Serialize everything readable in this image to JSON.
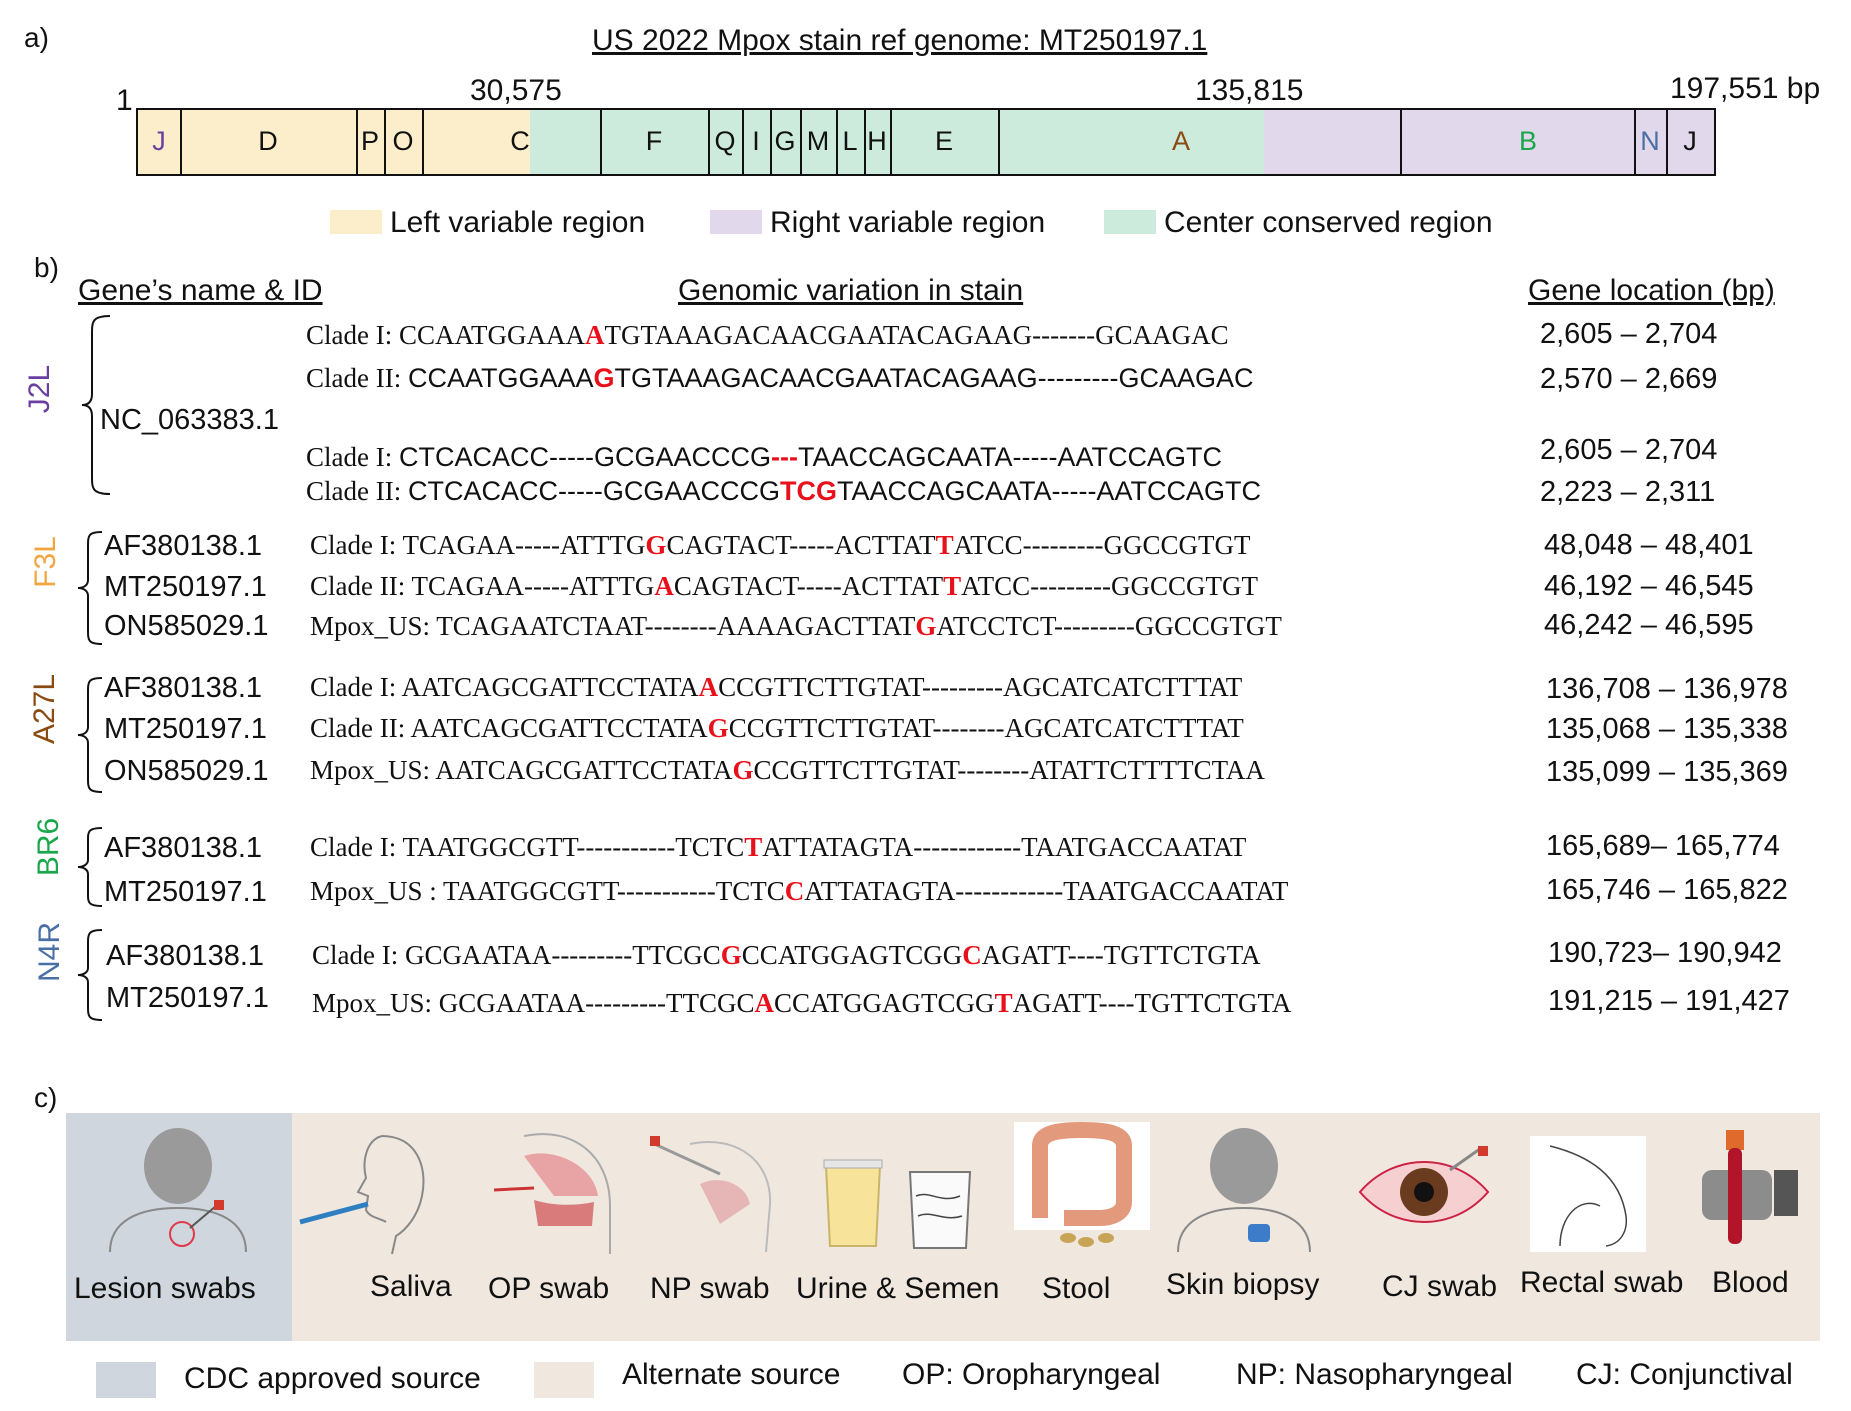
{
  "panel_a": {
    "label": "a)",
    "title": "US 2022 Mpox stain ref genome: MT250197.1",
    "coords": {
      "start": "1",
      "c1": "30,575",
      "c2": "135,815",
      "end": "197,551 bp"
    },
    "segments": [
      "J",
      "D",
      "P",
      "O",
      "C",
      "F",
      "Q",
      "I",
      "G",
      "M",
      "L",
      "H",
      "E",
      "A",
      "B",
      "N",
      "J"
    ],
    "legend": {
      "left": "Left variable region",
      "right": "Right variable region",
      "center": "Center conserved region"
    },
    "colors": {
      "left": "#fdeecb",
      "right": "#e2d8ec",
      "center": "#cdebdd"
    }
  },
  "panel_b": {
    "label": "b)",
    "headers": {
      "gene": "Gene’s name & ID",
      "variation": "Genomic variation in stain",
      "location": "Gene location (bp)"
    },
    "genes": {
      "j2l": {
        "name": "J2L",
        "acc": "NC_063383.1",
        "color": "#6b3fa0"
      },
      "f3l": {
        "name": "F3L",
        "acc1": "AF380138.1",
        "acc2": "MT250197.1",
        "acc3": "ON585029.1",
        "color": "#f2a541"
      },
      "a27l": {
        "name": "A27L",
        "acc1": "AF380138.1",
        "acc2": "MT250197.1",
        "acc3": "ON585029.1",
        "color": "#8a4b10"
      },
      "br6": {
        "name": "BR6",
        "acc1": "AF380138.1",
        "acc2": "MT250197.1",
        "color": "#1aa64b"
      },
      "n4r": {
        "name": "N4R",
        "acc1": "AF380138.1",
        "acc2": "MT250197.1",
        "color": "#4a6fa5"
      }
    },
    "rows": [
      {
        "pre": "Clade I: ",
        "s1": "CCAATGGAAA",
        "m1": "A",
        "s2": "TGTAAAGACAACGAATACAGAAG-------GCAAGAC",
        "loc": "2,605 – 2,704"
      },
      {
        "pre": "Clade II: ",
        "s1": "CCAATGGAAA",
        "m1": "G",
        "s2": "TGTAAAGACAACGAATACAGAAG---------GCAAGAC",
        "loc": "2,570 – 2,669"
      },
      {
        "pre": "Clade I: ",
        "s1": "CTCACACC-----GCGAACCCG",
        "m1": "---",
        "s2": "TAACCAGCAATA-----AATCCAGTC",
        "loc": "2,605 – 2,704"
      },
      {
        "pre": "Clade II: ",
        "s1": "CTCACACC-----GCGAACCCG",
        "m1": "TCG",
        "s2": "TAACCAGCAATA-----AATCCAGTC",
        "loc": "2,223 – 2,311"
      },
      {
        "pre": "Clade I: ",
        "s1": "TCAGAA-----ATTTG",
        "m1": "G",
        "s2": "CAGTACT-----ACTTAT",
        "m2": "T",
        "s3": "ATCC---------GGCCGTGT",
        "loc": "48,048 – 48,401"
      },
      {
        "pre": "Clade II: ",
        "s1": "TCAGAA-----ATTTG",
        "m1": "A",
        "s2": "CAGTACT-----ACTTAT",
        "m2": "T",
        "s3": "ATCC---------GGCCGTGT",
        "loc": "46,192 – 46,545"
      },
      {
        "pre": "Mpox_US:  ",
        "s1": "TCAGAATCTAAT--------AAAAGACTTAT",
        "m1": "G",
        "s2": "ATCCTCT---------GGCCGTGT",
        "loc": "46,242 – 46,595"
      },
      {
        "pre": "Clade I: ",
        "s1": "AATCAGCGATTCCTATA",
        "m1": "A",
        "s2": "CCGTTCTTGTAT---------AGCATCATCTTTAT",
        "loc": "136,708 – 136,978"
      },
      {
        "pre": "Clade II:  ",
        "s1": "AATCAGCGATTCCTATA",
        "m1": "G",
        "s2": "CCGTTCTTGTAT--------AGCATCATCTTTAT",
        "loc": "135,068 – 135,338"
      },
      {
        "pre": "Mpox_US:  ",
        "s1": "AATCAGCGATTCCTATA",
        "m1": "G",
        "s2": "CCGTTCTTGTAT--------ATATTCTTTTCTAA",
        "loc": "135,099 – 135,369"
      },
      {
        "pre": "Clade I: ",
        "s1": "TAATGGCGTT-----------TCTC",
        "m1": "T",
        "s2": "ATTATAGTA------------TAATGACCAATAT",
        "loc": "165,689– 165,774"
      },
      {
        "pre": "Mpox_US : ",
        "s1": "TAATGGCGTT-----------TCTC",
        "m1": "C",
        "s2": "ATTATAGTA------------TAATGACCAATAT",
        "loc": "165,746 – 165,822"
      },
      {
        "pre": "Clade I: ",
        "s1": "GCGAATAA---------TTCGC",
        "m1": "G",
        "s2": "CCATGGAGTCGG",
        "m2": "C",
        "s3": "AGATT----TGTTCTGTA",
        "loc": "190,723– 190,942"
      },
      {
        "pre": "Mpox_US: ",
        "s1": "GCGAATAA---------TTCGC",
        "m1": "A",
        "s2": "CCATGGAGTCGG",
        "m2": "T",
        "s3": "AGATT----TGTTCTGTA",
        "loc": "191,215 – 191,427"
      }
    ]
  },
  "panel_c": {
    "label": "c)",
    "sources": [
      "Lesion swabs",
      "Saliva",
      "OP swab",
      "NP swab",
      "Urine & Semen",
      "Stool",
      "Skin biopsy",
      "CJ  swab",
      "Rectal swab",
      "Blood"
    ],
    "legend": {
      "cdc": "CDC approved source",
      "alt": "Alternate source",
      "op": "OP: Oropharyngeal",
      "np": "NP: Nasopharyngeal",
      "cj": "CJ: Conjunctival"
    },
    "colors": {
      "cdc": "#cfd6de",
      "alt": "#f0e8df"
    }
  }
}
